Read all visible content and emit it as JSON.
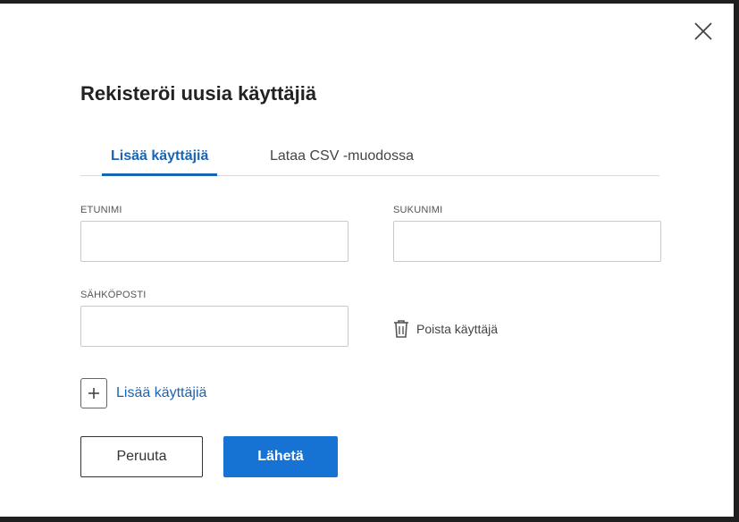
{
  "dialog": {
    "title": "Rekisteröi uusia käyttäjiä",
    "close_icon": "close-icon"
  },
  "tabs": [
    {
      "label": "Lisää käyttäjiä",
      "active": true
    },
    {
      "label": "Lataa CSV -muodossa",
      "active": false
    }
  ],
  "form": {
    "first_name": {
      "label": "ETUNIMI",
      "value": ""
    },
    "last_name": {
      "label": "SUKUNIMI",
      "value": ""
    },
    "email": {
      "label": "SÄHKÖPOSTI",
      "value": ""
    },
    "remove_user_label": "Poista käyttäjä",
    "remove_user_icon": "trash-icon",
    "add_user_label": "Lisää käyttäjiä",
    "add_user_icon": "plus-icon"
  },
  "actions": {
    "cancel_label": "Peruuta",
    "submit_label": "Lähetä"
  },
  "colors": {
    "accent": "#1a64b4",
    "primary_button": "#1673d4",
    "overlay": "#1f1f1f"
  }
}
